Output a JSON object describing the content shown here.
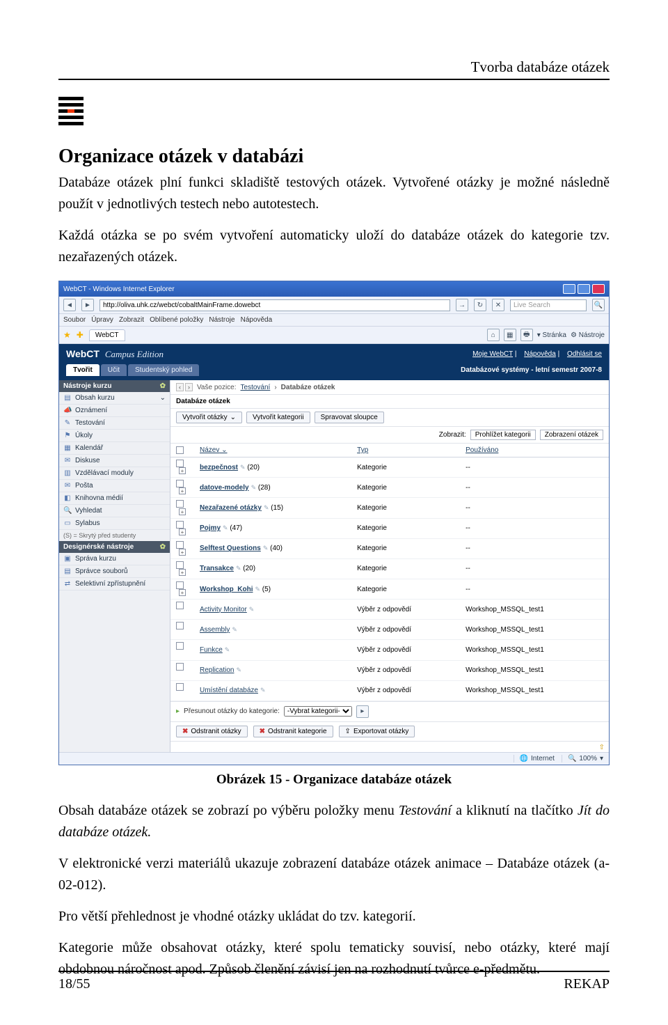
{
  "doc": {
    "running_head": "Tvorba databáze otázek",
    "section_title": "Organizace otázek v databázi",
    "para1": "Databáze otázek plní funkci skladiště testových otázek. Vytvořené otázky je možné následně použít v jednotlivých testech nebo autotestech.",
    "para2": "Každá otázka se po svém vytvoření automaticky uloží do databáze otázek do kategorie tzv. nezařazených otázek.",
    "caption": "Obrázek 15 - Organizace  databáze otázek",
    "para3a": "Obsah databáze otázek se zobrazí po výběru položky menu  ",
    "para3_i1": "Testování",
    "para3b": "  a kliknutí na tlačítko ",
    "para3_i2": "Jít do databáze otázek.",
    "para4": "V elektronické verzi materiálů ukazuje zobrazení databáze otázek animace – Databáze otázek (a-02-012).",
    "para5": "Pro větší  přehlednost je vhodné otázky ukládat do tzv. kategorií.",
    "para6": "Kategorie může obsahovat otázky, které spolu tematicky souvisí, nebo otázky, které mají obdobnou náročnost apod. Způsob členění závisí jen na rozhodnutí tvůrce e-předmětu.",
    "page_num": "18/55",
    "footer_right": "REKAP"
  },
  "shot": {
    "win_title": "WebCT - Windows Internet Explorer",
    "url": "http://oliva.uhk.cz/webct/cobaltMainFrame.dowebct",
    "search_ph": "Live Search",
    "ie_menu": [
      "Soubor",
      "Úpravy",
      "Zobrazit",
      "Oblíbené položky",
      "Nástroje",
      "Nápověda"
    ],
    "fav_tab": "WebCT",
    "fav_right": [
      "Stránka",
      "Nástroje"
    ],
    "brand_a": "WebCT",
    "brand_b": "Campus Edition",
    "top_links": [
      "Moje WebCT",
      "Nápověda",
      "Odhlásit se"
    ],
    "modes": [
      "Tvořit",
      "Učit",
      "Studentský pohled"
    ],
    "course_label": "Databázové systémy - letní semestr 2007-8",
    "nav_head1": "Nástroje kurzu",
    "nav1": [
      "Obsah kurzu",
      "Oznámení",
      "Testování",
      "Úkoly",
      "Kalendář",
      "Diskuse",
      "Vzdělávací moduly",
      "Pošta",
      "Knihovna médií",
      "Vyhledat",
      "Sylabus"
    ],
    "nav_note": "(S) = Skrytý před studenty",
    "nav_head2": "Designérské nástroje",
    "nav2": [
      "Správa kurzu",
      "Správce souborů",
      "Selektivní zpřístupnění"
    ],
    "bc_label": "Vaše pozice:",
    "bc_link": "Testování",
    "bc_current": "Databáze otázek",
    "panel_title": "Databáze otázek",
    "btn_create_q": "Vytvořit otázky",
    "btn_create_cat": "Vytvořit kategorii",
    "btn_cols": "Spravovat sloupce",
    "display_label": "Zobrazit:",
    "display_sel": "Prohlížet kategorii",
    "display_opt2": "Zobrazení otázek",
    "th_name": "Název",
    "th_type": "Typ",
    "th_used": "Používáno",
    "rows": [
      {
        "n": "bezpečnost",
        "c": "(20)",
        "t": "Kategorie",
        "u": "--",
        "exp": true,
        "bold": true
      },
      {
        "n": "datove-modely",
        "c": "(28)",
        "t": "Kategorie",
        "u": "--",
        "exp": true,
        "bold": true
      },
      {
        "n": "Nezařazené otázky",
        "c": "(15)",
        "t": "Kategorie",
        "u": "--",
        "exp": true,
        "bold": true,
        "pencil": false
      },
      {
        "n": "Pojmy",
        "c": "(47)",
        "t": "Kategorie",
        "u": "--",
        "exp": true,
        "bold": true
      },
      {
        "n": "Selftest Questions",
        "c": "(40)",
        "t": "Kategorie",
        "u": "--",
        "exp": true,
        "bold": true
      },
      {
        "n": "Transakce",
        "c": "(20)",
        "t": "Kategorie",
        "u": "--",
        "exp": true,
        "bold": true
      },
      {
        "n": "Workshop_Kohi",
        "c": "(5)",
        "t": "Kategorie",
        "u": "--",
        "exp": true,
        "bold": true
      },
      {
        "n": "Activity Monitor",
        "c": "",
        "t": "Výběr z odpovědí",
        "u": "Workshop_MSSQL_test1",
        "exp": false,
        "bold": false
      },
      {
        "n": "Assembly",
        "c": "",
        "t": "Výběr z odpovědí",
        "u": "Workshop_MSSQL_test1",
        "exp": false,
        "bold": false
      },
      {
        "n": "Funkce",
        "c": "",
        "t": "Výběr z odpovědí",
        "u": "Workshop_MSSQL_test1",
        "exp": false,
        "bold": false
      },
      {
        "n": "Replication",
        "c": "",
        "t": "Výběr z odpovědí",
        "u": "Workshop_MSSQL_test1",
        "exp": false,
        "bold": false
      },
      {
        "n": "Umístění databáze",
        "c": "",
        "t": "Výběr z odpovědí",
        "u": "Workshop_MSSQL_test1",
        "exp": false,
        "bold": false
      }
    ],
    "move_label": "Přesunout otázky do kategorie:",
    "move_sel": "-Vybrat kategorii-",
    "del_q": "Odstranit otázky",
    "del_cat": "Odstranit kategorie",
    "export": "Exportovat otázky",
    "status_zone": "Internet",
    "zoom": "100%"
  }
}
